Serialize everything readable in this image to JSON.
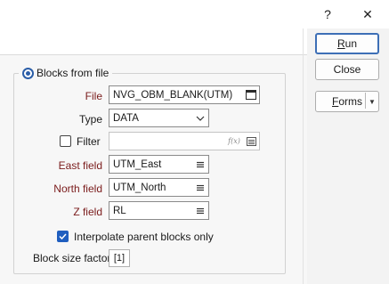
{
  "titlebar": {
    "help_glyph": "?",
    "close_glyph": "✕"
  },
  "actions": {
    "run_label": "Run",
    "close_label": "Close",
    "forms_label": "Forms",
    "forms_dropdown_glyph": "▼"
  },
  "group": {
    "title": "Blocks from file",
    "selected": true
  },
  "fields": {
    "file": {
      "label": "File",
      "value": "NVG_OBM_BLANK(UTM)"
    },
    "type": {
      "label": "Type",
      "value": "DATA"
    },
    "filter": {
      "label": "Filter",
      "value": "",
      "checked": false,
      "expr_icon_text": "f(x)"
    },
    "east": {
      "label": "East field",
      "value": "UTM_East"
    },
    "north": {
      "label": "North field",
      "value": "UTM_North"
    },
    "z": {
      "label": "Z field",
      "value": "RL"
    }
  },
  "interpolate": {
    "label": "Interpolate parent blocks only",
    "checked": true
  },
  "block_size": {
    "label": "Block size factor",
    "value": "[1]"
  }
}
